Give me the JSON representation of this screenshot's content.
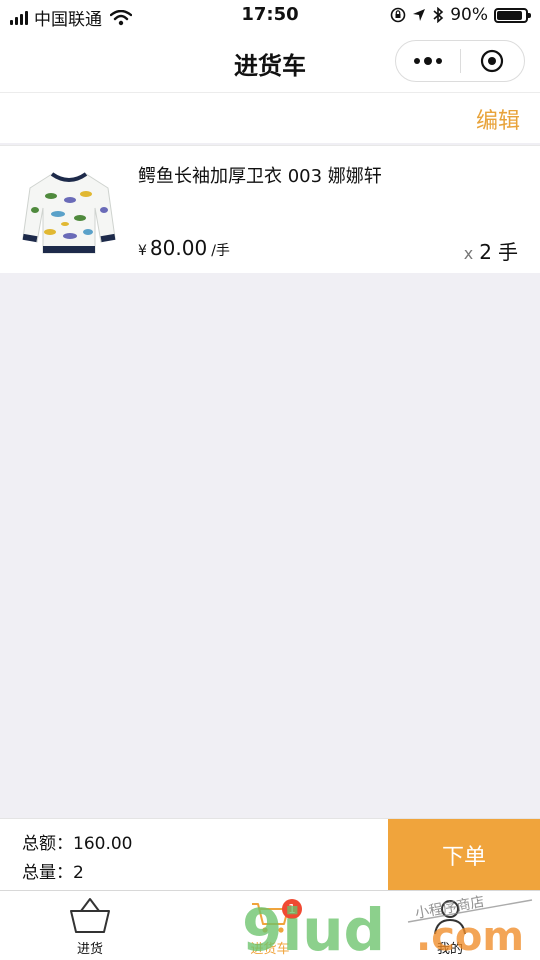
{
  "status_bar": {
    "carrier": "中国联通",
    "time": "17:50",
    "battery": "90%",
    "battery_level": 0.9
  },
  "nav": {
    "title": "进货车"
  },
  "edit": {
    "label": "编辑"
  },
  "cart": {
    "items": [
      {
        "title": "鳄鱼长袖加厚卫衣 003 娜娜轩",
        "currency": "¥",
        "price": "80.00",
        "unit": "/手",
        "qty_prefix": "x",
        "qty": "2",
        "qty_unit": "手"
      }
    ]
  },
  "summary": {
    "total_label": "总额：",
    "total_value": "160.00",
    "count_label": "总量：",
    "count_value": "2",
    "order_button": "下单"
  },
  "tabs": [
    {
      "label": "进货",
      "icon": "basket-icon",
      "active": false
    },
    {
      "label": "进货车",
      "icon": "cart-icon",
      "active": true,
      "badge": "1"
    },
    {
      "label": "我的",
      "icon": "user-icon",
      "active": false
    }
  ],
  "colors": {
    "accent": "#f0a43c",
    "badge": "#f04a32",
    "background": "#f0eff4"
  },
  "watermark": {
    "text": "9iud.com",
    "caption": "小程序商店"
  }
}
